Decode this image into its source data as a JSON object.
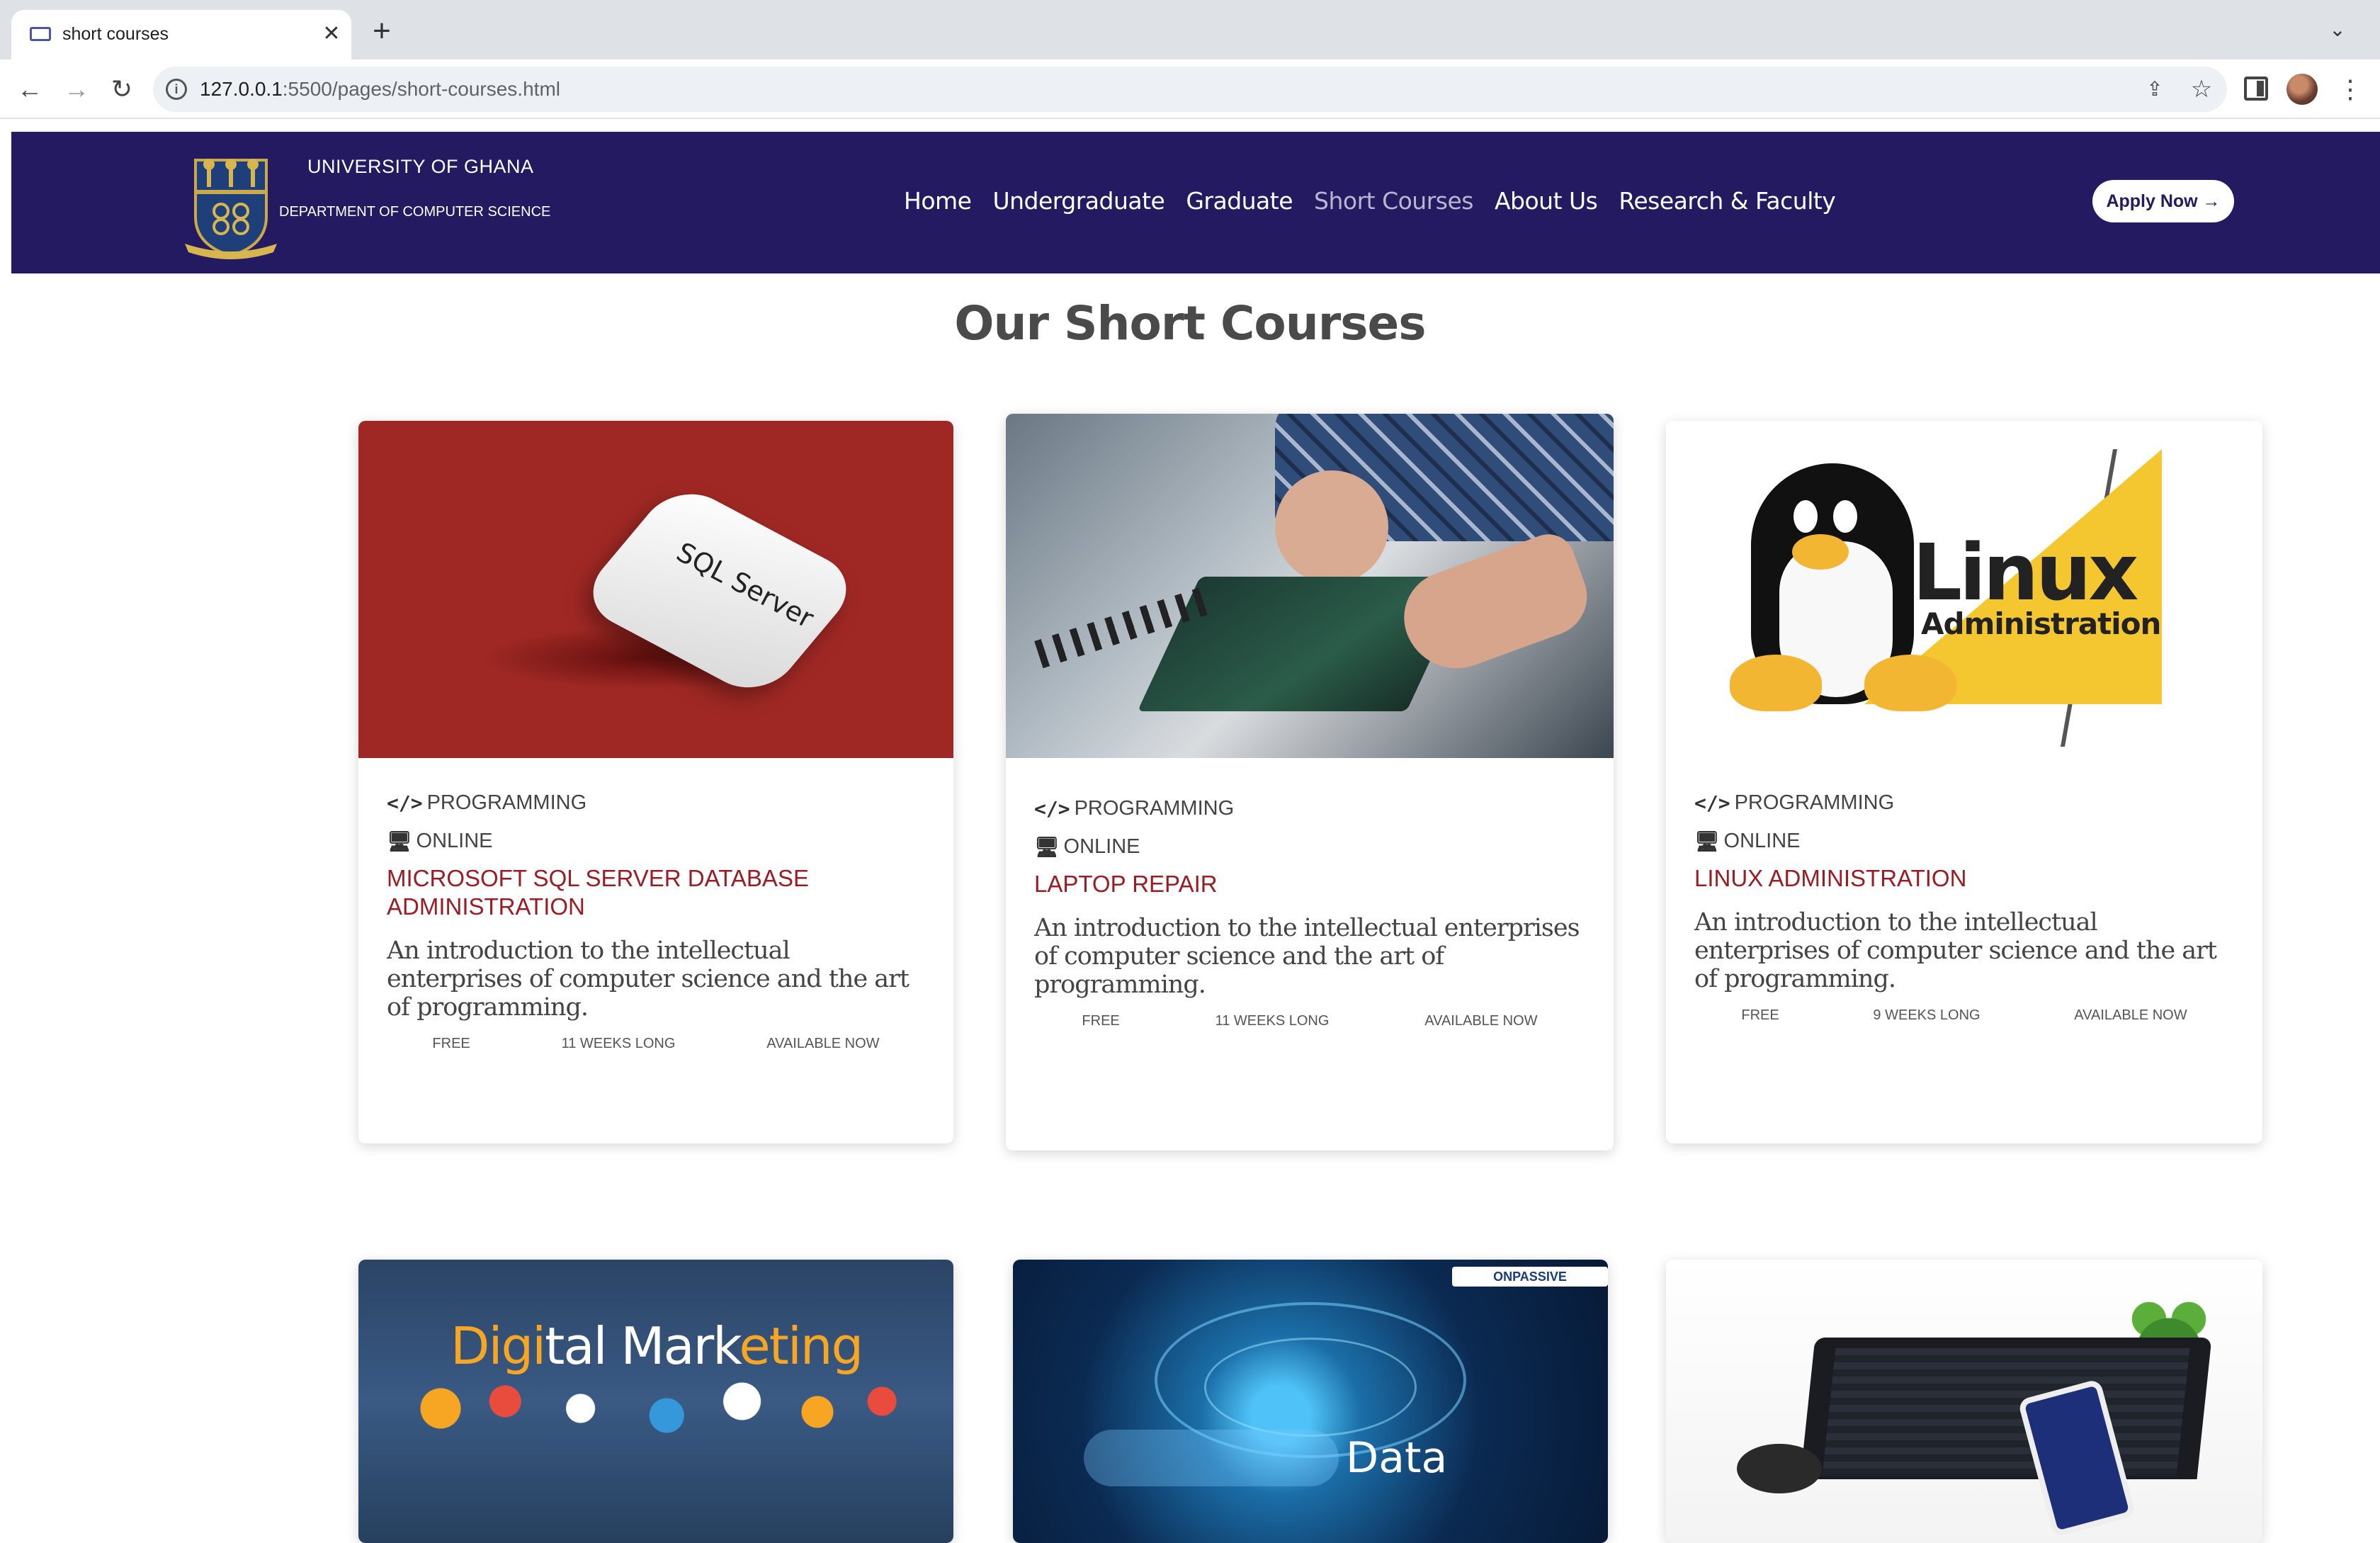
{
  "browser": {
    "tab_title": "short courses",
    "tab_close": "✕",
    "new_tab": "+",
    "tab_menu": "⌄",
    "url_host": "127.0.0.1",
    "url_rest": ":5500/pages/short-courses.html",
    "nav_back": "←",
    "nav_forward": "→",
    "nav_reload": "↻",
    "share_icon": "⇪",
    "star_icon": "☆",
    "menu_icon": "⋮",
    "info_icon": "i"
  },
  "header": {
    "university": "UNIVERSITY OF GHANA",
    "department": "DEPARTMENT OF COMPUTER SCIENCE",
    "nav": [
      {
        "label": "Home",
        "active": false
      },
      {
        "label": "Undergraduate",
        "active": false
      },
      {
        "label": "Graduate",
        "active": false
      },
      {
        "label": "Short Courses",
        "active": true
      },
      {
        "label": "About Us",
        "active": false
      },
      {
        "label": "Research & Faculty",
        "active": false
      }
    ],
    "apply_label": "Apply Now →",
    "background_color": "#231a62"
  },
  "page": {
    "title": "Our Short Courses"
  },
  "courses": [
    {
      "category": "PROGRAMMING",
      "mode": "ONLINE",
      "title": "MICROSOFT SQL SERVER DATABASE ADMINISTRATION",
      "description": "An introduction to the intellectual enterprises of computer science and the art of programming.",
      "price": "FREE",
      "duration": "11 WEEKS LONG",
      "availability": "AVAILABLE NOW",
      "image_text": "SQL Server"
    },
    {
      "category": "PROGRAMMING",
      "mode": "ONLINE",
      "title": "LAPTOP REPAIR",
      "description": "An introduction to the intellectual enterprises of computer science and the art of programming.",
      "price": "FREE",
      "duration": "11 WEEKS LONG",
      "availability": "AVAILABLE NOW"
    },
    {
      "category": "PROGRAMMING",
      "mode": "ONLINE",
      "title": "LINUX ADMINISTRATION",
      "description": "An introduction to the intellectual enterprises of computer science and the art of programming.",
      "price": "FREE",
      "duration": "9 WEEKS LONG",
      "availability": "AVAILABLE NOW",
      "image_text": "Linux",
      "image_subtext": "Administration"
    },
    {
      "image_text_a": "Digi",
      "image_text_b": "tal Mark",
      "image_text_c": "eting"
    },
    {
      "image_badge": "ONPASSIVE",
      "image_text": "Data"
    },
    {}
  ],
  "icons": {
    "category_icon": "</>",
    "mode_icon": "🖥"
  },
  "colors": {
    "accent_title": "#9b1c24",
    "header_bg": "#231a62"
  }
}
